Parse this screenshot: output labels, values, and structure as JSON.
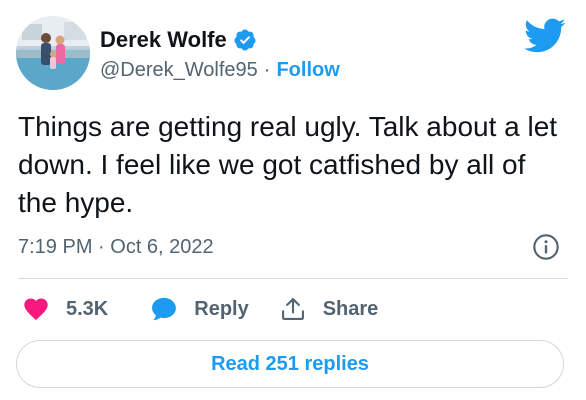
{
  "author": {
    "display_name": "Derek Wolfe",
    "handle": "@Derek_Wolfe95",
    "separator": "·",
    "follow_label": "Follow",
    "verified": true
  },
  "tweet": {
    "text": "Things are getting real ugly. Talk about a let down. I feel like we got catfished by all of the hype.",
    "timestamp": "7:19 PM · Oct 6, 2022"
  },
  "actions": {
    "like_count": "5.3K",
    "reply_label": "Reply",
    "share_label": "Share"
  },
  "read_replies_label": "Read 251 replies",
  "icons": {
    "brand": "twitter-bird-icon",
    "verified": "verified-badge-icon",
    "info": "info-icon",
    "like": "heart-icon",
    "reply": "speech-bubble-icon",
    "share": "share-upload-icon"
  },
  "colors": {
    "accent": "#1d9bf0",
    "like": "#f91880",
    "text": "#0f1419",
    "muted": "#536471",
    "border": "#cfd9de"
  }
}
